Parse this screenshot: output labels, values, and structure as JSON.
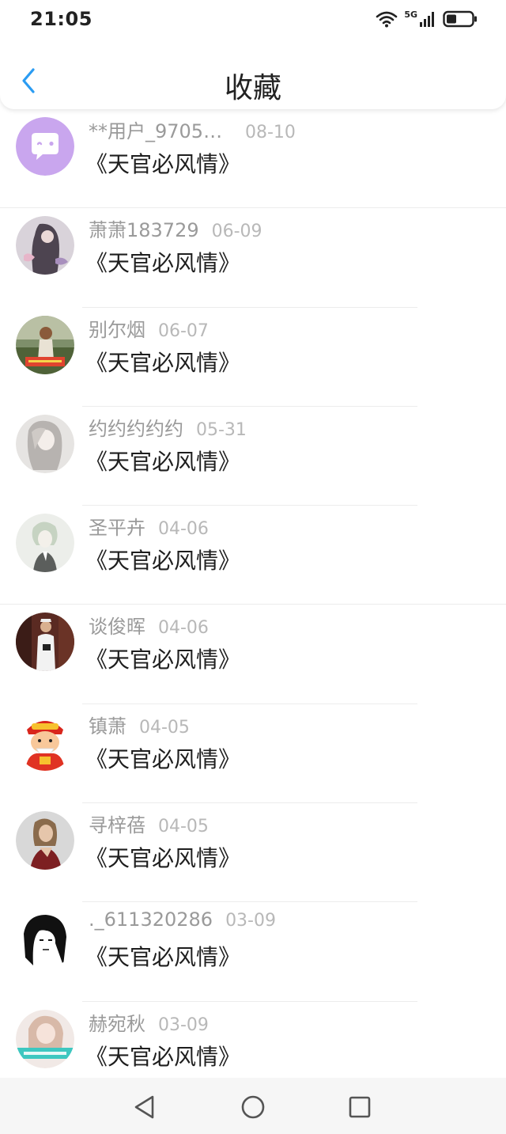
{
  "status_bar": {
    "time": "21:05",
    "network": "5G"
  },
  "header": {
    "title": "收藏"
  },
  "favorites": [
    {
      "name": "**用户_97051...",
      "date": "08-10",
      "book": "《天官必风情》",
      "avatar_icon": "chat-bubble-avatar-icon"
    },
    {
      "name": "萧萧183729",
      "date": "06-09",
      "book": "《天官必风情》",
      "avatar_icon": "user-photo-avatar"
    },
    {
      "name": "别尔烟",
      "date": "06-07",
      "book": "《天官必风情》",
      "avatar_icon": "user-photo-avatar"
    },
    {
      "name": "约约约约约",
      "date": "05-31",
      "book": "《天官必风情》",
      "avatar_icon": "user-photo-avatar"
    },
    {
      "name": "圣平卉",
      "date": "04-06",
      "book": "《天官必风情》",
      "avatar_icon": "user-photo-avatar"
    },
    {
      "name": "谈俊晖",
      "date": "04-06",
      "book": "《天官必风情》",
      "avatar_icon": "user-photo-avatar"
    },
    {
      "name": "镇萧",
      "date": "04-05",
      "book": "《天官必风情》",
      "avatar_icon": "fortune-god-avatar"
    },
    {
      "name": "寻梓蓓",
      "date": "04-05",
      "book": "《天官必风情》",
      "avatar_icon": "user-photo-avatar"
    },
    {
      "name": "._611320286",
      "date": "03-09",
      "book": "《天官必风情》",
      "avatar_icon": "manga-girl-avatar"
    },
    {
      "name": "赫宛秋",
      "date": "03-09",
      "book": "《天官必风情》",
      "avatar_icon": "user-photo-avatar"
    }
  ],
  "colors": {
    "accent": "#2b9cf2",
    "chat_avatar_bg": "#c9a6ee"
  }
}
